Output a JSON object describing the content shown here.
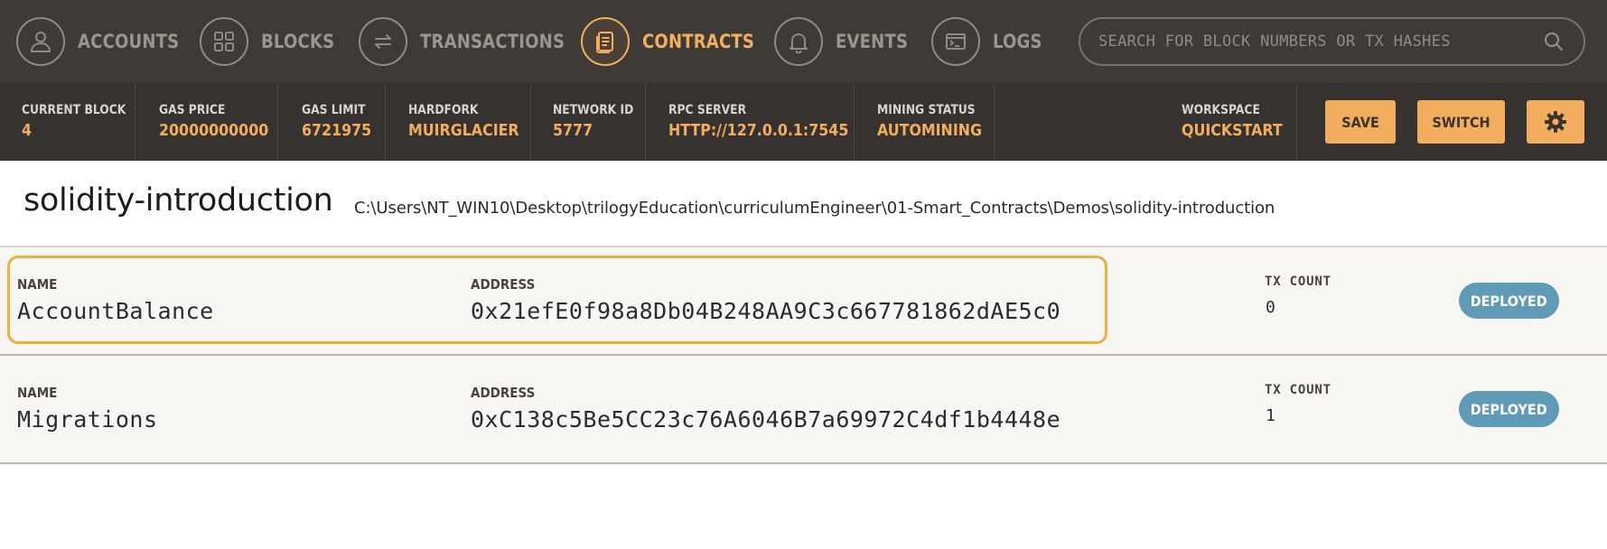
{
  "nav": {
    "items": [
      {
        "label": "ACCOUNTS",
        "icon": "person-icon",
        "active": false
      },
      {
        "label": "BLOCKS",
        "icon": "grid-icon",
        "active": false
      },
      {
        "label": "TRANSACTIONS",
        "icon": "swap-arrows-icon",
        "active": false
      },
      {
        "label": "CONTRACTS",
        "icon": "document-icon",
        "active": true
      },
      {
        "label": "EVENTS",
        "icon": "bell-icon",
        "active": false
      },
      {
        "label": "LOGS",
        "icon": "terminal-icon",
        "active": false
      }
    ],
    "search": {
      "placeholder": "SEARCH FOR BLOCK NUMBERS OR TX HASHES",
      "value": ""
    },
    "accent_color": "#f2ad5e"
  },
  "status": {
    "current_block": {
      "label": "CURRENT BLOCK",
      "value": "4"
    },
    "gas_price": {
      "label": "GAS PRICE",
      "value": "20000000000"
    },
    "gas_limit": {
      "label": "GAS LIMIT",
      "value": "6721975"
    },
    "hardfork": {
      "label": "HARDFORK",
      "value": "MUIRGLACIER"
    },
    "network_id": {
      "label": "NETWORK ID",
      "value": "5777"
    },
    "rpc_server": {
      "label": "RPC SERVER",
      "value": "HTTP://127.0.0.1:7545"
    },
    "mining_status": {
      "label": "MINING STATUS",
      "value": "AUTOMINING"
    },
    "workspace": {
      "label": "WORKSPACE",
      "value": "QUICKSTART"
    },
    "save_label": "SAVE",
    "switch_label": "SWITCH",
    "settings_icon": "gear-icon"
  },
  "project": {
    "title": "solidity-introduction",
    "path": "C:\\Users\\NT_WIN10\\Desktop\\trilogyEducation\\curriculumEngineer\\01-Smart_Contracts\\Demos\\solidity-introduction"
  },
  "contracts": [
    {
      "name_label": "NAME",
      "name": "AccountBalance",
      "address_label": "ADDRESS",
      "address": "0x21efE0f98a8Db04B248AA9C3c667781862dAE5c0",
      "tx_count_label": "TX COUNT",
      "tx_count": "0",
      "status": "DEPLOYED",
      "highlighted": true
    },
    {
      "name_label": "NAME",
      "name": "Migrations",
      "address_label": "ADDRESS",
      "address": "0xC138c5Be5CC23c76A6046B7a69972C4df1b4448e",
      "tx_count_label": "TX COUNT",
      "tx_count": "1",
      "status": "DEPLOYED",
      "highlighted": false
    }
  ]
}
